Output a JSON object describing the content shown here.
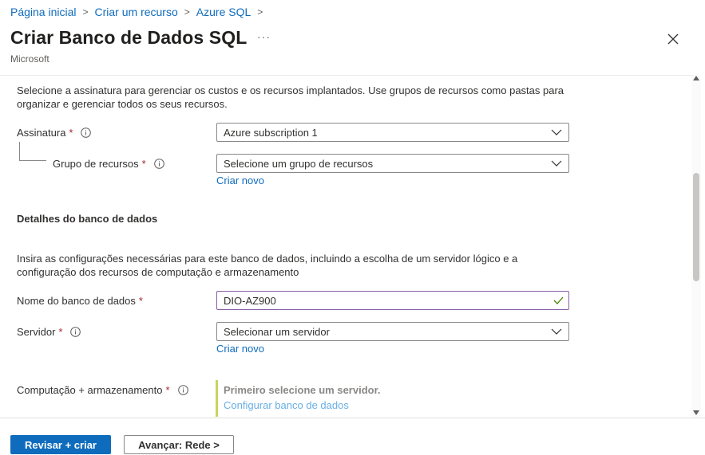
{
  "breadcrumb": {
    "items": [
      "Página inicial",
      "Criar um recurso",
      "Azure SQL"
    ],
    "separator": ">"
  },
  "header": {
    "title": "Criar Banco de Dados SQL",
    "more": "···",
    "subtitle": "Microsoft"
  },
  "project": {
    "description": "Selecione a assinatura para gerenciar os custos e os recursos implantados. Use grupos de recursos como pastas para organizar e gerenciar todos os seus recursos.",
    "subscription_label": "Assinatura",
    "subscription_value": "Azure subscription 1",
    "resource_group_label": "Grupo de recursos",
    "resource_group_value": "Selecione um grupo de recursos",
    "resource_group_create": "Criar novo"
  },
  "database": {
    "heading": "Detalhes do banco de dados",
    "description": "Insira as configurações necessárias para este banco de dados, incluindo a escolha de um servidor lógico e a configuração dos recursos de computação e armazenamento",
    "name_label": "Nome do banco de dados",
    "name_value": "DIO-AZ900",
    "server_label": "Servidor",
    "server_value": "Selecionar um servidor",
    "server_create": "Criar novo",
    "compute_label": "Computação + armazenamento",
    "compute_notice": "Primeiro selecione um servidor.",
    "compute_link": "Configurar banco de dados"
  },
  "required_mark": "*",
  "footer": {
    "review_create": "Revisar + criar",
    "next": "Avançar: Rede >"
  },
  "colors": {
    "accent": "#0f6cbd",
    "required": "#a4262c",
    "valid_border": "#8a5fa6",
    "valid_check": "#498205",
    "callout_bar": "#c7d55f"
  }
}
